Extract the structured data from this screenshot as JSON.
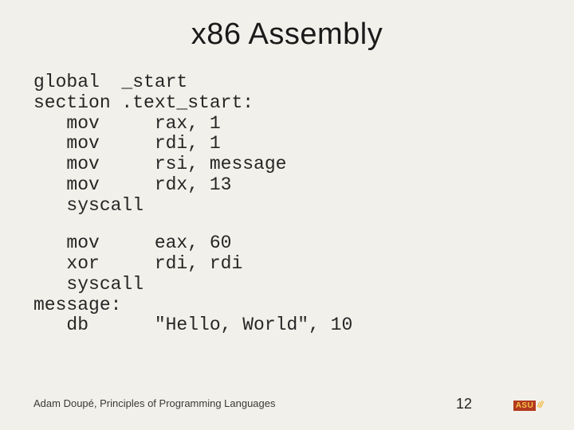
{
  "title": "x86 Assembly",
  "code_block1": "global  _start\nsection .text_start:\n   mov     rax, 1\n   mov     rdi, 1\n   mov     rsi, message\n   mov     rdx, 13\n   syscall",
  "code_block2": "   mov     eax, 60\n   xor     rdi, rdi\n   syscall\nmessage:\n   db      \"Hello, World\", 10",
  "footer": "Adam Doupé, Principles of Programming Languages",
  "page_number": "12",
  "logo_text": "ASU"
}
